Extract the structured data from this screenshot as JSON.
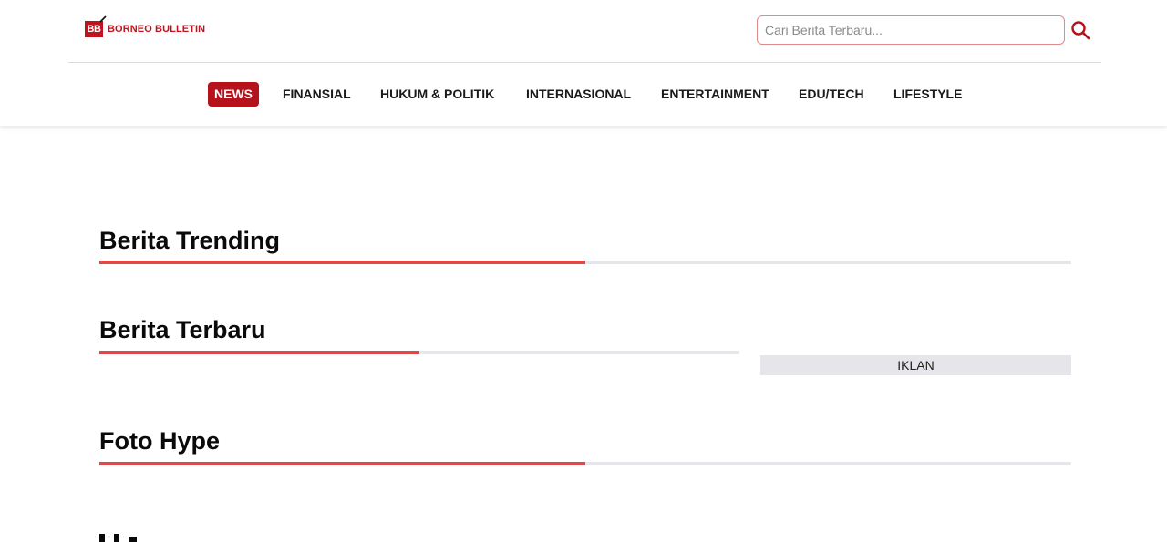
{
  "brand": {
    "mark": "BB",
    "name": "BORNEO BULLETIN",
    "color": "#c1121f"
  },
  "search": {
    "placeholder": "Cari Berita Terbaru...",
    "value": "",
    "icon": "search-icon"
  },
  "nav": {
    "items": [
      {
        "label": "NEWS",
        "active": true
      },
      {
        "label": "FINANSIAL",
        "active": false
      },
      {
        "label": "HUKUM & POLITIK",
        "active": false
      },
      {
        "label": "INTERNASIONAL",
        "active": false
      },
      {
        "label": "ENTERTAINMENT",
        "active": false
      },
      {
        "label": "EDU/TECH",
        "active": false
      },
      {
        "label": "LIFESTYLE",
        "active": false
      }
    ],
    "active_color": "#b5121b"
  },
  "sections": [
    {
      "title": "Berita Trending",
      "underline_progress": 0.5
    },
    {
      "title": "Berita Terbaru",
      "underline_progress": 0.5
    },
    {
      "title": "Foto Hype",
      "underline_progress": 0.5
    }
  ],
  "ad": {
    "label": "IKLAN"
  },
  "colors": {
    "accent": "#e14848",
    "track": "#e5e5ea"
  }
}
